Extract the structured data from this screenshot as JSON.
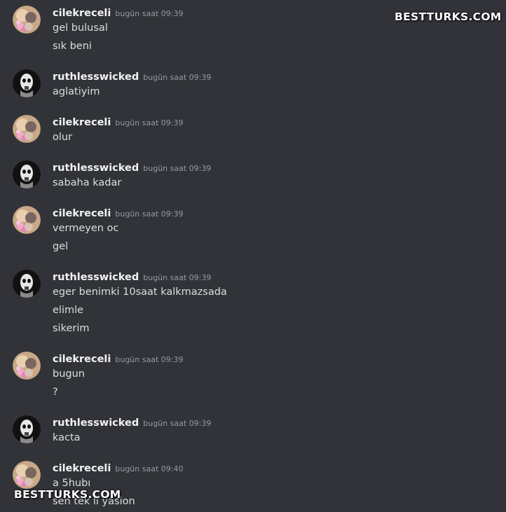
{
  "messages": [
    {
      "user": "cilekreceli",
      "avatar": "pink-flower-avatar",
      "time": "bugün saat 09:39",
      "lines": [
        "gel bulusal",
        "sık beni"
      ]
    },
    {
      "user": "ruthlesswicked",
      "avatar": "masked-face-avatar",
      "time": "bugün saat 09:39",
      "lines": [
        "aglatiyim"
      ]
    },
    {
      "user": "cilekreceli",
      "avatar": "pink-flower-avatar",
      "time": "bugün saat 09:39",
      "lines": [
        "olur"
      ]
    },
    {
      "user": "ruthlesswicked",
      "avatar": "masked-face-avatar",
      "time": "bugün saat 09:39",
      "lines": [
        "sabaha kadar"
      ]
    },
    {
      "user": "cilekreceli",
      "avatar": "pink-flower-avatar",
      "time": "bugün saat 09:39",
      "lines": [
        "vermeyen oc",
        "gel"
      ]
    },
    {
      "user": "ruthlesswicked",
      "avatar": "masked-face-avatar",
      "time": "bugün saat 09:39",
      "lines": [
        "eger benimki 10saat kalkmazsada",
        "elimle",
        "sikerim"
      ]
    },
    {
      "user": "cilekreceli",
      "avatar": "pink-flower-avatar",
      "time": "bugün saat 09:39",
      "lines": [
        "bugun",
        "?"
      ]
    },
    {
      "user": "ruthlesswicked",
      "avatar": "masked-face-avatar",
      "time": "bugün saat 09:39",
      "lines": [
        "kacta"
      ]
    },
    {
      "user": "cilekreceli",
      "avatar": "pink-flower-avatar",
      "time": "bugün saat 09:40",
      "lines": [
        "a 5hubı",
        "sen tek li yasion"
      ]
    }
  ],
  "watermarks": {
    "top": "BESTTURKS.COM",
    "bottom": "BESTTURKS.COM"
  },
  "colors": {
    "background": "#313338",
    "username": "#f2f3f5",
    "timestamp": "#949ba4",
    "message_text": "#dbdee1"
  }
}
